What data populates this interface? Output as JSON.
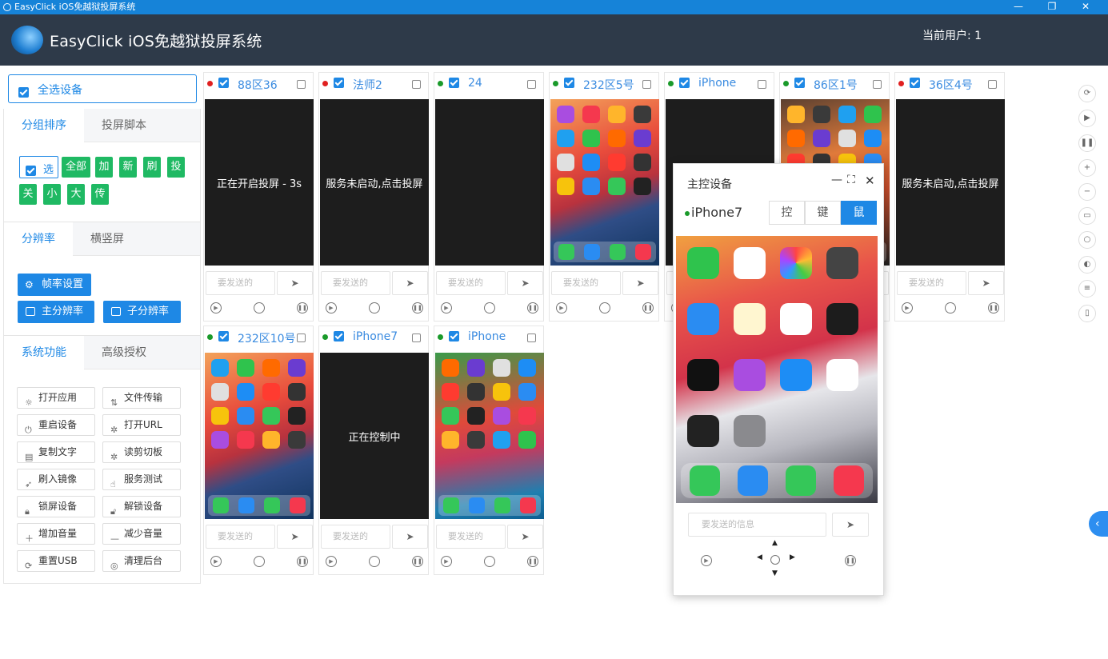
{
  "window": {
    "title": "EasyClick iOS免越狱投屏系统",
    "min": "—",
    "max": "❐",
    "close": "✕"
  },
  "header": {
    "title": "EasyClick iOS免越狱投屏系统",
    "user": "当前用户: 1"
  },
  "left": {
    "select_all": "全选设备",
    "tabs1": [
      "分组排序",
      "投屏脚本"
    ],
    "group_buttons": [
      "选",
      "全部",
      "加",
      "新",
      "刷",
      "投",
      "关",
      "小",
      "大",
      "传"
    ],
    "tabs2": [
      "分辨率",
      "横竖屏"
    ],
    "fps_btn": "帧率设置",
    "main_res": "主分辨率",
    "sub_res": "子分辨率",
    "tabs3": [
      "系统功能",
      "高级授权"
    ],
    "functions": [
      "打开应用",
      "文件传输",
      "重启设备",
      "打开URL",
      "复制文字",
      "读剪切板",
      "刷入镜像",
      "服务测试",
      "锁屏设备",
      "解锁设备",
      "增加音量",
      "减少音量",
      "重置USB",
      "清理后台"
    ]
  },
  "devices": [
    {
      "name": "88区36",
      "status": "red",
      "screen_text": "正在开启投屏 - 3s"
    },
    {
      "name": "法师2",
      "status": "red",
      "screen_text": "服务未启动,点击投屏"
    },
    {
      "name": "24",
      "status": "green",
      "screen_text": ""
    },
    {
      "name": "232区5号",
      "status": "green",
      "screen_text": ""
    },
    {
      "name": "iPhone",
      "status": "green",
      "screen_text": ""
    },
    {
      "name": "86区1号",
      "status": "green",
      "screen_text": ""
    },
    {
      "name": "36区4号",
      "status": "red",
      "screen_text": "服务未启动,点击投屏"
    },
    {
      "name": "232区10号",
      "status": "green",
      "screen_text": ""
    },
    {
      "name": "iPhone7",
      "status": "green",
      "screen_text": "正在控制中"
    },
    {
      "name": "iPhone",
      "status": "green",
      "screen_text": ""
    }
  ],
  "card": {
    "msg_placeholder": "要发送的",
    "send": "➤"
  },
  "master": {
    "title": "主控设备",
    "device": "iPhone7",
    "segs": [
      "控",
      "键",
      "鼠"
    ],
    "msg_placeholder": "要发送的信息",
    "send": "➤"
  },
  "colors": {
    "accent": "#1e88e5",
    "green": "#1fb963",
    "red": "#e02020",
    "status_green": "#1a9a2a"
  }
}
